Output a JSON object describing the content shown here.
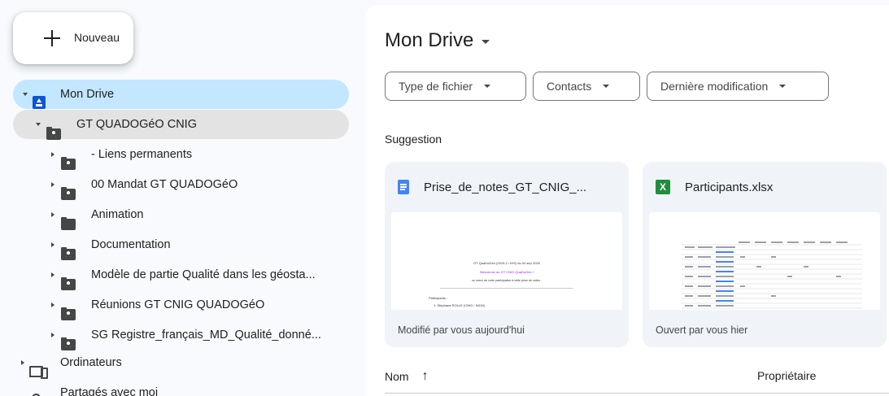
{
  "sidebar": {
    "new_button": "Nouveau",
    "my_drive": "Mon Drive",
    "folders": [
      {
        "label": "GT QUADOGéO CNIG",
        "icon": "shared-folder-icon"
      },
      {
        "label": "- Liens permanents",
        "icon": "shared-folder-icon"
      },
      {
        "label": "00 Mandat GT QUADOGéO",
        "icon": "shared-folder-icon"
      },
      {
        "label": "Animation",
        "icon": "folder-icon"
      },
      {
        "label": "Documentation",
        "icon": "shared-folder-icon"
      },
      {
        "label": "Modèle de partie Qualité dans les géosta...",
        "icon": "shared-folder-icon"
      },
      {
        "label": "Réunions GT CNIG QUADOGéO",
        "icon": "shared-folder-icon"
      },
      {
        "label": "SG Registre_français_MD_Qualité_donné...",
        "icon": "shared-folder-icon"
      }
    ],
    "computers": "Ordinateurs",
    "shared_with_me": "Partagés avec moi"
  },
  "main": {
    "title": "Mon Drive",
    "filters": [
      "Type de fichier",
      "Contacts",
      "Dernière modification"
    ],
    "suggestion_label": "Suggestion",
    "cards": [
      {
        "title": "Prise_de_notes_GT_CNIG_...",
        "footer": "Modifié par vous aujourd'hui",
        "type_icon": "google-docs-icon"
      },
      {
        "title": "Participants.xlsx",
        "footer": "Ouvert par vous hier",
        "type_icon": "excel-icon",
        "type_letter": "X"
      }
    ],
    "doc_preview": {
      "line1": "GT QuaDoGéo (2023-2 / IHS) du 04 sep 2025",
      "line2": "Bienvenue au GT CNIG QuaDoGéo !",
      "line3": "un merci de votre participation à cette prise de notes :",
      "participants": "Participants :",
      "item1": "1.   Stéphane ROLLE (CNIG / INGN)"
    },
    "list_headers": {
      "name": "Nom",
      "sort_icon": "↑",
      "owner": "Propriétaire"
    }
  },
  "colors": {
    "selected": "#c2e7ff",
    "expanded": "#e3e3e3",
    "accent": "#0b57d0",
    "sheets_green": "#1e8e3e",
    "docs_blue": "#4285f4"
  }
}
